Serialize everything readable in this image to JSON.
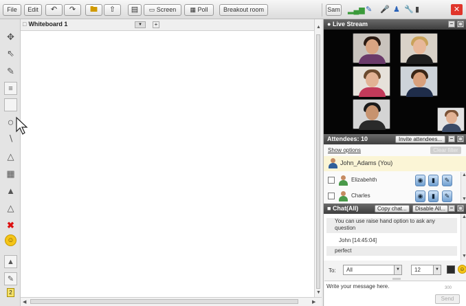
{
  "toolbar": {
    "file_label": "File",
    "edit_label": "Edit",
    "undo_icon": "undo-icon",
    "redo_icon": "redo-icon",
    "screen_label": "Screen",
    "poll_label": "Poll",
    "breakout_label": "Breakout room",
    "user_label": "Sam",
    "signal_icon": "signal-icon",
    "close_icon": "close-icon"
  },
  "whiteboard": {
    "tab_label": "Whiteboard 1"
  },
  "tools": [
    "pointer-icon",
    "arrow-icon",
    "pencil-icon",
    "text-icon",
    "rectangle-icon",
    "circle-icon",
    "line-icon",
    "triangle-icon",
    "table-icon",
    "eraser-icon",
    "eraser-all-icon",
    "clear-icon",
    "smiley-icon",
    "text-color-icon",
    "fill-color-icon"
  ],
  "tool_size_value": "2",
  "live_stream": {
    "title": "Live Stream"
  },
  "attendees": {
    "title": "Attendees: 10",
    "invite_label": "Invite attendees...",
    "show_options_label": "Show options",
    "clear_filter_label": "Clear filter",
    "you_name": "John_Adams (You)",
    "rows": [
      {
        "name": "Elizabehth"
      },
      {
        "name": "Charles"
      }
    ]
  },
  "chat": {
    "title": "Chat(All)",
    "copy_label": "Copy chat...",
    "disable_label": "Disable All...",
    "system_message": "You can use raise hand option to ask any question",
    "sender": "John [14:45:04]",
    "message": "perfect",
    "to_label": "To:",
    "to_value": "All",
    "font_size_value": "12",
    "input_placeholder": "Write your message here.",
    "send_label": "Send",
    "char_count": "300"
  },
  "colors": {
    "header_dark": "#4a4a4a",
    "you_row": "#fbf5d6",
    "close_red": "#e0352b"
  }
}
